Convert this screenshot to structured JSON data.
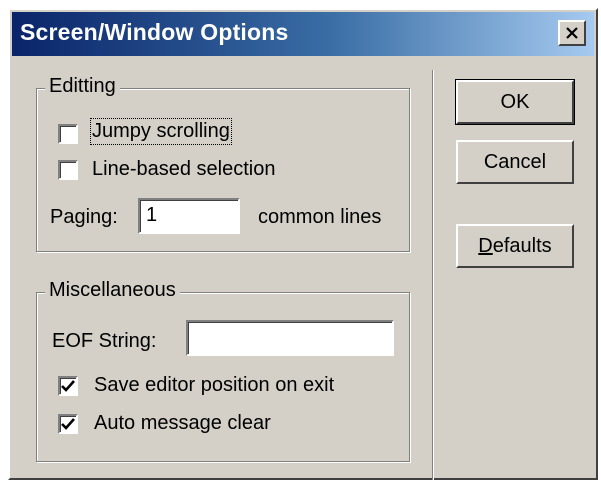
{
  "window": {
    "title": "Screen/Window Options",
    "close_icon": "close-icon"
  },
  "editing_group": {
    "legend": "Editting",
    "jumpy_scrolling": {
      "label": "Jumpy scrolling",
      "checked": false
    },
    "line_based_selection": {
      "label": "Line-based selection",
      "checked": false
    },
    "paging_label": "Paging:",
    "paging_value": "1",
    "paging_suffix": "common lines"
  },
  "misc_group": {
    "legend": "Miscellaneous",
    "eof_label": "EOF String:",
    "eof_value": "",
    "save_editor_position": {
      "label": "Save editor position on exit",
      "checked": true
    },
    "auto_message_clear": {
      "label": "Auto message clear",
      "checked": true
    }
  },
  "buttons": {
    "ok": "OK",
    "cancel": "Cancel",
    "defaults_first": "D",
    "defaults_rest": "efaults"
  },
  "colors": {
    "titlebar_start": "#0a246a",
    "titlebar_end": "#a6caf0",
    "face": "#d4d0c8"
  }
}
